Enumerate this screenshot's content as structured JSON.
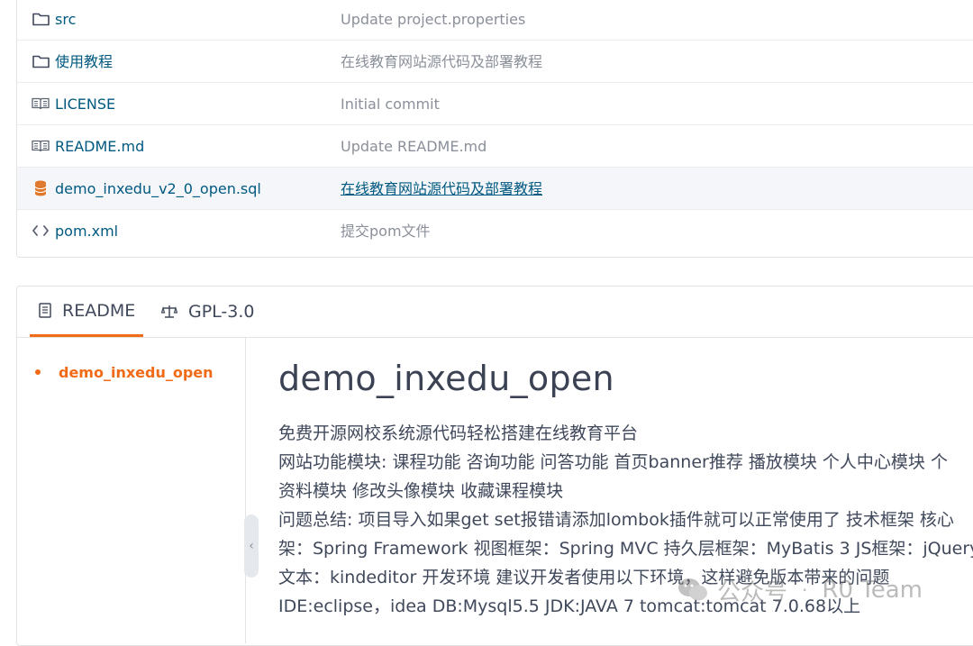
{
  "files": [
    {
      "name": "src",
      "icon": "folder-icon",
      "message": "Update project.properties"
    },
    {
      "name": "使用教程",
      "icon": "folder-icon",
      "message": "在线教育网站源代码及部署教程"
    },
    {
      "name": "LICENSE",
      "icon": "book-icon",
      "message": "Initial commit"
    },
    {
      "name": "README.md",
      "icon": "book-icon",
      "message": "Update README.md"
    },
    {
      "name": "demo_inxedu_v2_0_open.sql",
      "icon": "database-icon",
      "message": "在线教育网站源代码及部署教程"
    },
    {
      "name": "pom.xml",
      "icon": "code-icon",
      "message": "提交pom文件"
    }
  ],
  "tabs": {
    "readme": "README",
    "license": "GPL-3.0"
  },
  "toc": {
    "item": "demo_inxedu_open"
  },
  "readme": {
    "title": "demo_inxedu_open",
    "lines": [
      "免费开源网校系统源代码轻松搭建在线教育平台",
      "网站功能模块: 课程功能 咨询功能 问答功能 首页banner推荐 播放模块 个人中心模块 个",
      "资料模块 修改头像模块 收藏课程模块",
      "问题总结: 项目导入如果get set报错请添加lombok插件就可以正常使用了 技术框架 核心",
      "架：Spring Framework 视图框架：Spring MVC 持久层框架：MyBatis 3 JS框架：jQuery",
      "文本：kindeditor 开发环境 建议开发者使用以下环境，这样避免版本带来的问题",
      "IDE:eclipse，idea DB:Mysql5.5 JDK:JAVA 7 tomcat:tomcat 7.0.68以上"
    ]
  },
  "watermark": {
    "left": "公众号",
    "right": "R0 Team"
  },
  "colors": {
    "accent": "#f06a17",
    "link": "#005980",
    "muted": "#8a8f99"
  }
}
